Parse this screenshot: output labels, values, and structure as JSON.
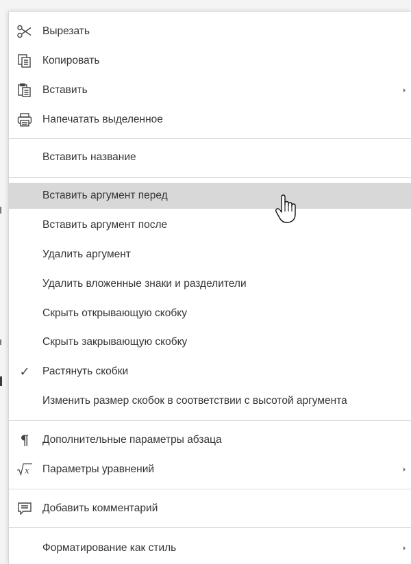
{
  "context_menu": {
    "items": [
      {
        "label": "Вырезать",
        "icon": "scissors-icon"
      },
      {
        "label": "Копировать",
        "icon": "copy-icon"
      },
      {
        "label": "Вставить",
        "icon": "paste-icon",
        "submenu": true
      },
      {
        "label": "Напечатать выделенное",
        "icon": "printer-icon"
      },
      {
        "label": "Вставить название"
      },
      {
        "label": "Вставить аргумент перед",
        "highlighted": true
      },
      {
        "label": "Вставить аргумент после"
      },
      {
        "label": "Удалить аргумент"
      },
      {
        "label": "Удалить вложенные знаки и разделители"
      },
      {
        "label": "Скрыть открывающую скобку"
      },
      {
        "label": "Скрыть закрывающую скобку"
      },
      {
        "label": "Растянуть скобки",
        "checked": true,
        "icon": "checkmark-icon"
      },
      {
        "label": "Изменить размер скобок в соответствии с высотой аргумента"
      },
      {
        "label": "Дополнительные параметры абзаца",
        "icon": "pilcrow-icon"
      },
      {
        "label": "Параметры уравнений",
        "icon": "square-root-icon",
        "submenu": true
      },
      {
        "label": "Добавить комментарий",
        "icon": "comment-icon"
      },
      {
        "label": "Форматирование как стиль",
        "submenu": true
      }
    ]
  },
  "colors": {
    "hover_background": "#d8d8d8",
    "separator": "#d9d9d9",
    "text": "#333333"
  }
}
